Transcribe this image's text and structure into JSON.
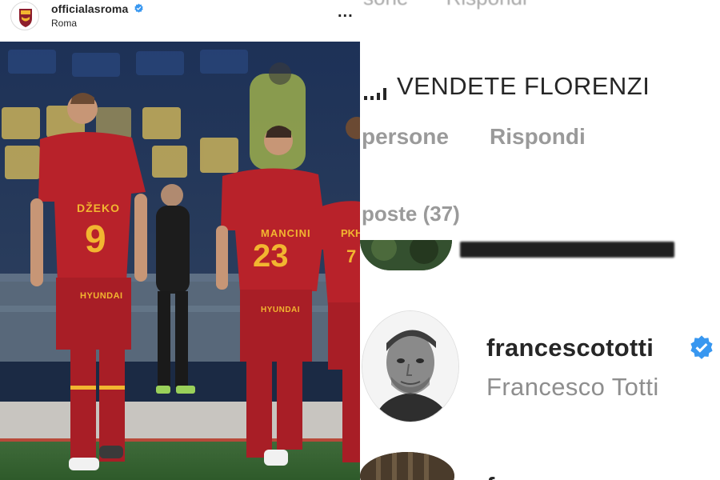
{
  "post": {
    "username": "officialasroma",
    "location": "Roma",
    "more_label": "...",
    "players": [
      {
        "name": "DŽEKO",
        "number": "9"
      },
      {
        "name": "MANCINI",
        "number": "23"
      },
      {
        "name": "PKH",
        "number": "7"
      }
    ],
    "sponsor": "HYUNDAI"
  },
  "comments": {
    "faded_top": [
      "sone",
      "Rispondi"
    ],
    "comment_text": "VENDETE FLORENZI",
    "meta_people": "persone",
    "meta_reply": "Rispondi",
    "replies_label": "poste (37)",
    "reply_user": {
      "handle": "francescototti",
      "full_name": "Francesco Totti"
    },
    "bottom_handle_crop": "f"
  },
  "colors": {
    "verified": "#3897f0",
    "kit_red": "#b8222a",
    "kit_yellow": "#f2b630",
    "text_dark": "#262626",
    "text_gray": "#8e8e8e"
  }
}
